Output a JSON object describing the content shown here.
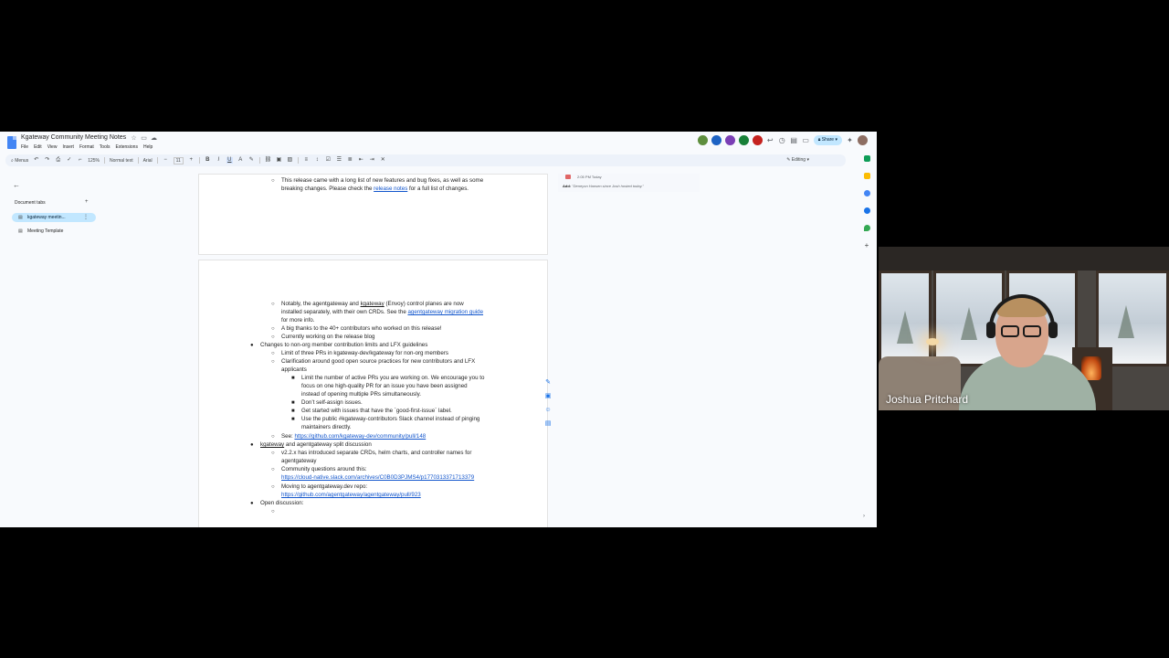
{
  "docs": {
    "title": "Kgateway Community Meeting Notes",
    "menu": [
      "File",
      "Edit",
      "View",
      "Insert",
      "Format",
      "Tools",
      "Extensions",
      "Help"
    ],
    "share_label": "Share"
  },
  "toolbar": {
    "menus_label": "Menus",
    "zoom": "125%",
    "style": "Normal text",
    "font": "Arial",
    "font_size": "11",
    "mode": "Editing"
  },
  "left_panel": {
    "heading": "Document tabs",
    "tabs": [
      {
        "label": "kgateway meetin...",
        "active": true
      },
      {
        "label": "Meeting Template",
        "active": false
      }
    ]
  },
  "comment": {
    "time": "2:05 PM Today",
    "add_label": "Add:",
    "text": "\"Deneyon Hansen since Josh hosted today.\""
  },
  "page1": {
    "line1": "This release came with a long list of new features and bug fixes, as well as some",
    "line2_a": "breaking changes. Please check the ",
    "line2_link": "release notes",
    "line2_b": " for a full list of changes."
  },
  "page2": {
    "l1_a": "Notably, the agentgateway and ",
    "l1_u": "kgateway",
    "l1_b": " (Envoy) control planes are now",
    "l2_a": "installed separately, with their own CRDs. See the ",
    "l2_link": "agentgateway migration guide",
    "l3": "for more info.",
    "l4": "A big thanks to the 40+ contributors who worked on this release!",
    "l5": "Currently working on the release blog",
    "l6": "Changes to non-org member contribution limits and LFX guidelines",
    "l7": "Limit of three PRs in kgateway-dev/kgateway for non-org members",
    "l8": "Clarification around good open source practices for new contributors and LFX",
    "l9": "applicants",
    "l10": "Limit the number of active PRs you are working on. We encourage you to",
    "l11": "focus on one high-quality PR for an issue you have been assigned",
    "l12": "instead of opening multiple PRs simultaneously.",
    "l13": "Don’t self-assign issues.",
    "l14": "Get started with issues that have the `good-first-issue` label.",
    "l15": "Use the public #kgateway-contributors Slack channel instead of pinging",
    "l16": "maintainers directly.",
    "l17_a": "See: ",
    "l17_link": "https://github.com/kgateway-dev/community/pull/148",
    "l18_u": "kgateway",
    "l18_b": " and agentgateway split discussion",
    "l19": "v2.2.x has introduced separate CRDs, helm charts, and controller names for",
    "l20": "agentgateway",
    "l21": "Community questions around this:",
    "l22_link": "https://cloud-native.slack.com/archives/C0B0D3PJMS4/p1770313371713379",
    "l23": "Moving to agentgateway.dev repo:",
    "l24_link": "https://github.com/agentgateway/agentgateway/pull/923",
    "l25": "Open discussion:"
  },
  "webcam": {
    "participant_name": "Joshua Pritchard"
  },
  "colors": {
    "link": "#1155cc",
    "share_bg": "#c2e7ff",
    "active_tab_bg": "#c2e7ff",
    "docs_bg": "#f8fafd"
  },
  "icons": {
    "star": "star-icon",
    "move": "folder-icon",
    "cloud": "cloud-status-icon",
    "history": "history-icon",
    "comments": "comment-icon",
    "meet": "video-call-icon",
    "gemini": "gemini-icon"
  }
}
